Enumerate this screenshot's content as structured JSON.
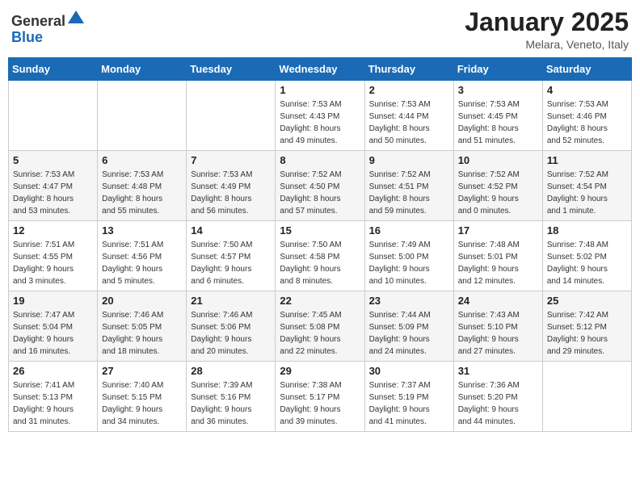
{
  "logo": {
    "general": "General",
    "blue": "Blue"
  },
  "header": {
    "title": "January 2025",
    "subtitle": "Melara, Veneto, Italy"
  },
  "weekdays": [
    "Sunday",
    "Monday",
    "Tuesday",
    "Wednesday",
    "Thursday",
    "Friday",
    "Saturday"
  ],
  "weeks": [
    [
      {
        "day": "",
        "info": ""
      },
      {
        "day": "",
        "info": ""
      },
      {
        "day": "",
        "info": ""
      },
      {
        "day": "1",
        "info": "Sunrise: 7:53 AM\nSunset: 4:43 PM\nDaylight: 8 hours\nand 49 minutes."
      },
      {
        "day": "2",
        "info": "Sunrise: 7:53 AM\nSunset: 4:44 PM\nDaylight: 8 hours\nand 50 minutes."
      },
      {
        "day": "3",
        "info": "Sunrise: 7:53 AM\nSunset: 4:45 PM\nDaylight: 8 hours\nand 51 minutes."
      },
      {
        "day": "4",
        "info": "Sunrise: 7:53 AM\nSunset: 4:46 PM\nDaylight: 8 hours\nand 52 minutes."
      }
    ],
    [
      {
        "day": "5",
        "info": "Sunrise: 7:53 AM\nSunset: 4:47 PM\nDaylight: 8 hours\nand 53 minutes."
      },
      {
        "day": "6",
        "info": "Sunrise: 7:53 AM\nSunset: 4:48 PM\nDaylight: 8 hours\nand 55 minutes."
      },
      {
        "day": "7",
        "info": "Sunrise: 7:53 AM\nSunset: 4:49 PM\nDaylight: 8 hours\nand 56 minutes."
      },
      {
        "day": "8",
        "info": "Sunrise: 7:52 AM\nSunset: 4:50 PM\nDaylight: 8 hours\nand 57 minutes."
      },
      {
        "day": "9",
        "info": "Sunrise: 7:52 AM\nSunset: 4:51 PM\nDaylight: 8 hours\nand 59 minutes."
      },
      {
        "day": "10",
        "info": "Sunrise: 7:52 AM\nSunset: 4:52 PM\nDaylight: 9 hours\nand 0 minutes."
      },
      {
        "day": "11",
        "info": "Sunrise: 7:52 AM\nSunset: 4:54 PM\nDaylight: 9 hours\nand 1 minute."
      }
    ],
    [
      {
        "day": "12",
        "info": "Sunrise: 7:51 AM\nSunset: 4:55 PM\nDaylight: 9 hours\nand 3 minutes."
      },
      {
        "day": "13",
        "info": "Sunrise: 7:51 AM\nSunset: 4:56 PM\nDaylight: 9 hours\nand 5 minutes."
      },
      {
        "day": "14",
        "info": "Sunrise: 7:50 AM\nSunset: 4:57 PM\nDaylight: 9 hours\nand 6 minutes."
      },
      {
        "day": "15",
        "info": "Sunrise: 7:50 AM\nSunset: 4:58 PM\nDaylight: 9 hours\nand 8 minutes."
      },
      {
        "day": "16",
        "info": "Sunrise: 7:49 AM\nSunset: 5:00 PM\nDaylight: 9 hours\nand 10 minutes."
      },
      {
        "day": "17",
        "info": "Sunrise: 7:48 AM\nSunset: 5:01 PM\nDaylight: 9 hours\nand 12 minutes."
      },
      {
        "day": "18",
        "info": "Sunrise: 7:48 AM\nSunset: 5:02 PM\nDaylight: 9 hours\nand 14 minutes."
      }
    ],
    [
      {
        "day": "19",
        "info": "Sunrise: 7:47 AM\nSunset: 5:04 PM\nDaylight: 9 hours\nand 16 minutes."
      },
      {
        "day": "20",
        "info": "Sunrise: 7:46 AM\nSunset: 5:05 PM\nDaylight: 9 hours\nand 18 minutes."
      },
      {
        "day": "21",
        "info": "Sunrise: 7:46 AM\nSunset: 5:06 PM\nDaylight: 9 hours\nand 20 minutes."
      },
      {
        "day": "22",
        "info": "Sunrise: 7:45 AM\nSunset: 5:08 PM\nDaylight: 9 hours\nand 22 minutes."
      },
      {
        "day": "23",
        "info": "Sunrise: 7:44 AM\nSunset: 5:09 PM\nDaylight: 9 hours\nand 24 minutes."
      },
      {
        "day": "24",
        "info": "Sunrise: 7:43 AM\nSunset: 5:10 PM\nDaylight: 9 hours\nand 27 minutes."
      },
      {
        "day": "25",
        "info": "Sunrise: 7:42 AM\nSunset: 5:12 PM\nDaylight: 9 hours\nand 29 minutes."
      }
    ],
    [
      {
        "day": "26",
        "info": "Sunrise: 7:41 AM\nSunset: 5:13 PM\nDaylight: 9 hours\nand 31 minutes."
      },
      {
        "day": "27",
        "info": "Sunrise: 7:40 AM\nSunset: 5:15 PM\nDaylight: 9 hours\nand 34 minutes."
      },
      {
        "day": "28",
        "info": "Sunrise: 7:39 AM\nSunset: 5:16 PM\nDaylight: 9 hours\nand 36 minutes."
      },
      {
        "day": "29",
        "info": "Sunrise: 7:38 AM\nSunset: 5:17 PM\nDaylight: 9 hours\nand 39 minutes."
      },
      {
        "day": "30",
        "info": "Sunrise: 7:37 AM\nSunset: 5:19 PM\nDaylight: 9 hours\nand 41 minutes."
      },
      {
        "day": "31",
        "info": "Sunrise: 7:36 AM\nSunset: 5:20 PM\nDaylight: 9 hours\nand 44 minutes."
      },
      {
        "day": "",
        "info": ""
      }
    ]
  ]
}
